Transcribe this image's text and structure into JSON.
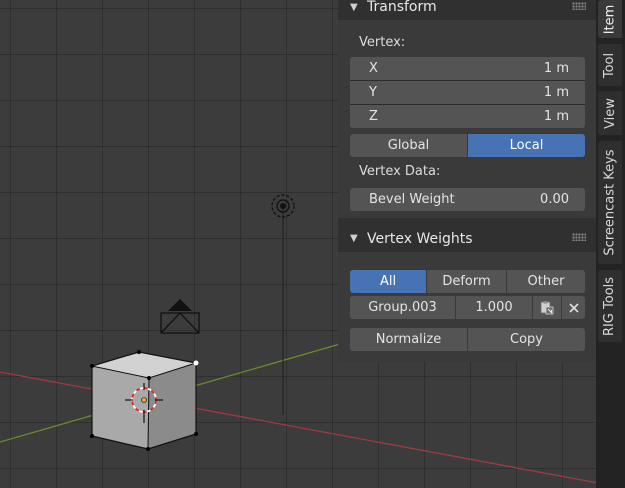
{
  "transform_panel": {
    "title": "Transform",
    "vertex_label": "Vertex:",
    "fields": [
      {
        "label": "X",
        "value": "1 m"
      },
      {
        "label": "Y",
        "value": "1 m"
      },
      {
        "label": "Z",
        "value": "1 m"
      }
    ],
    "space_buttons": {
      "global": "Global",
      "local": "Local",
      "selected": "Local"
    },
    "vertex_data_label": "Vertex Data:",
    "bevel_weight": {
      "label": "Bevel Weight",
      "value": "0.00"
    }
  },
  "vertex_weights_panel": {
    "title": "Vertex Weights",
    "filter_buttons": {
      "all": "All",
      "deform": "Deform",
      "other": "Other",
      "selected": "All"
    },
    "group_row": {
      "name": "Group.003",
      "weight": "1.000",
      "paste_icon": "paste-to-selected-icon",
      "remove_icon": "close-icon"
    },
    "normalize_label": "Normalize",
    "copy_label": "Copy"
  },
  "sidebar_tabs": [
    {
      "label": "Item",
      "active": true
    },
    {
      "label": "Tool",
      "active": false
    },
    {
      "label": "View",
      "active": false
    },
    {
      "label": "Screencast Keys",
      "active": false
    },
    {
      "label": "RIG Tools",
      "active": false
    }
  ],
  "colors": {
    "accent": "#4772b3",
    "x_axis": "#9e3a44",
    "y_axis": "#6b8c2a",
    "panel_bg": "#3a3a3a",
    "header_bg": "#303030",
    "widget_bg": "#545454"
  }
}
